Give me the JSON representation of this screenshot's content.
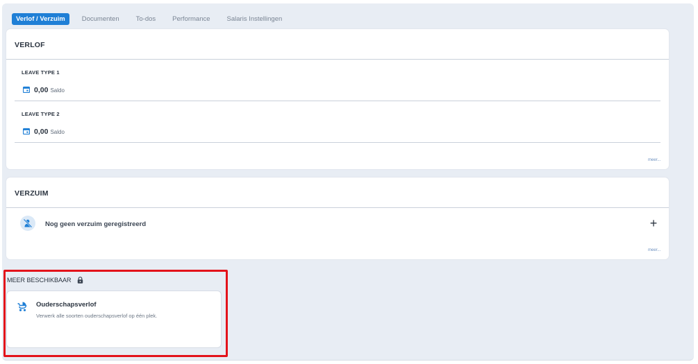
{
  "tabs": [
    {
      "label": "Verlof / Verzuim",
      "active": true
    },
    {
      "label": "Documenten",
      "active": false
    },
    {
      "label": "To-dos",
      "active": false
    },
    {
      "label": "Performance",
      "active": false
    },
    {
      "label": "Salaris Instellingen",
      "active": false
    }
  ],
  "verlof": {
    "title": "VERLOF",
    "items": [
      {
        "label": "LEAVE TYPE 1",
        "value": "0,00",
        "unit": "Saldo",
        "icon": "calendar-icon"
      },
      {
        "label": "LEAVE TYPE 2",
        "value": "0,00",
        "unit": "Saldo",
        "icon": "calendar-icon"
      }
    ],
    "more_link": "meer..."
  },
  "verzuim": {
    "title": "VERZUIM",
    "empty_text": "Nog geen verzuim geregistreerd",
    "empty_icon": "no-sick-person-icon",
    "add_label": "+",
    "more_link": "meer..."
  },
  "meer_beschikbaar": {
    "title": "MEER BESCHIKBAAR",
    "lock_icon": "lock-icon",
    "feature": {
      "title": "Ouderschapsverlof",
      "description": "Verwerk alle soorten ouderschapsverlof op één plek.",
      "icon": "stroller-icon"
    }
  },
  "colors": {
    "accent": "#1f7fd6",
    "background": "#e8edf4",
    "highlight": "#e3131b"
  }
}
